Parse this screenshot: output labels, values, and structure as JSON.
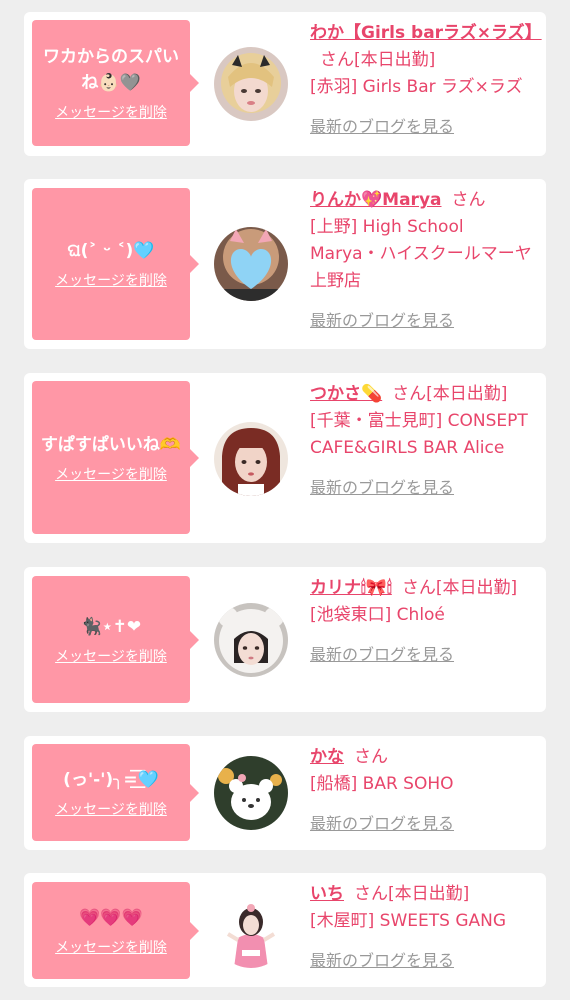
{
  "colors": {
    "background": "#eeeeee",
    "card": "#ffffff",
    "bubble": "#ff97a6",
    "accent": "#e8456b",
    "blog_link": "#999999"
  },
  "delete_label": "メッセージを削除",
  "blog_label": "最新のブログを見る",
  "san_label": "さん",
  "cards": [
    {
      "message": "ワカからのスパいね👶🏻🩶",
      "name": "わか【Girls barラズ×ラズ】",
      "status": "[本日出勤]",
      "shop": "[赤羽] Girls Bar ラズ×ラズ",
      "avatar": "avatar-blonde-girl"
    },
    {
      "message": "ଘ(˃ ᵕ ˂)🩵",
      "name": "りんか💖Marya",
      "status": "",
      "shop": "[上野] High School Marya・ハイスクールマーヤ上野店",
      "avatar": "avatar-heart-face"
    },
    {
      "message": "すぱすぱいいね🫶",
      "name": "つかさ💊",
      "status": "[本日出勤]",
      "shop": "[千葉・富士見町] CONSEPT CAFE&GIRLS BAR Alice",
      "avatar": "avatar-red-hair-girl"
    },
    {
      "message": "🐈‍⬛⋆✝❤",
      "name": "カリナ🕯🎀🕯",
      "status": "[本日出勤]",
      "shop": "[池袋東口] Chloé",
      "avatar": "avatar-white-hood-girl"
    },
    {
      "message": "(っ'-')╮=͟͟͞͞🩵",
      "name": "かな",
      "status": "",
      "shop": "[船橋] BAR SOHO",
      "avatar": "avatar-bear-sticker"
    },
    {
      "message": "💗💗💗",
      "name": "いち",
      "status": "[本日出勤]",
      "shop": "[木屋町] SWEETS GANG",
      "avatar": "avatar-idol-girl"
    }
  ]
}
